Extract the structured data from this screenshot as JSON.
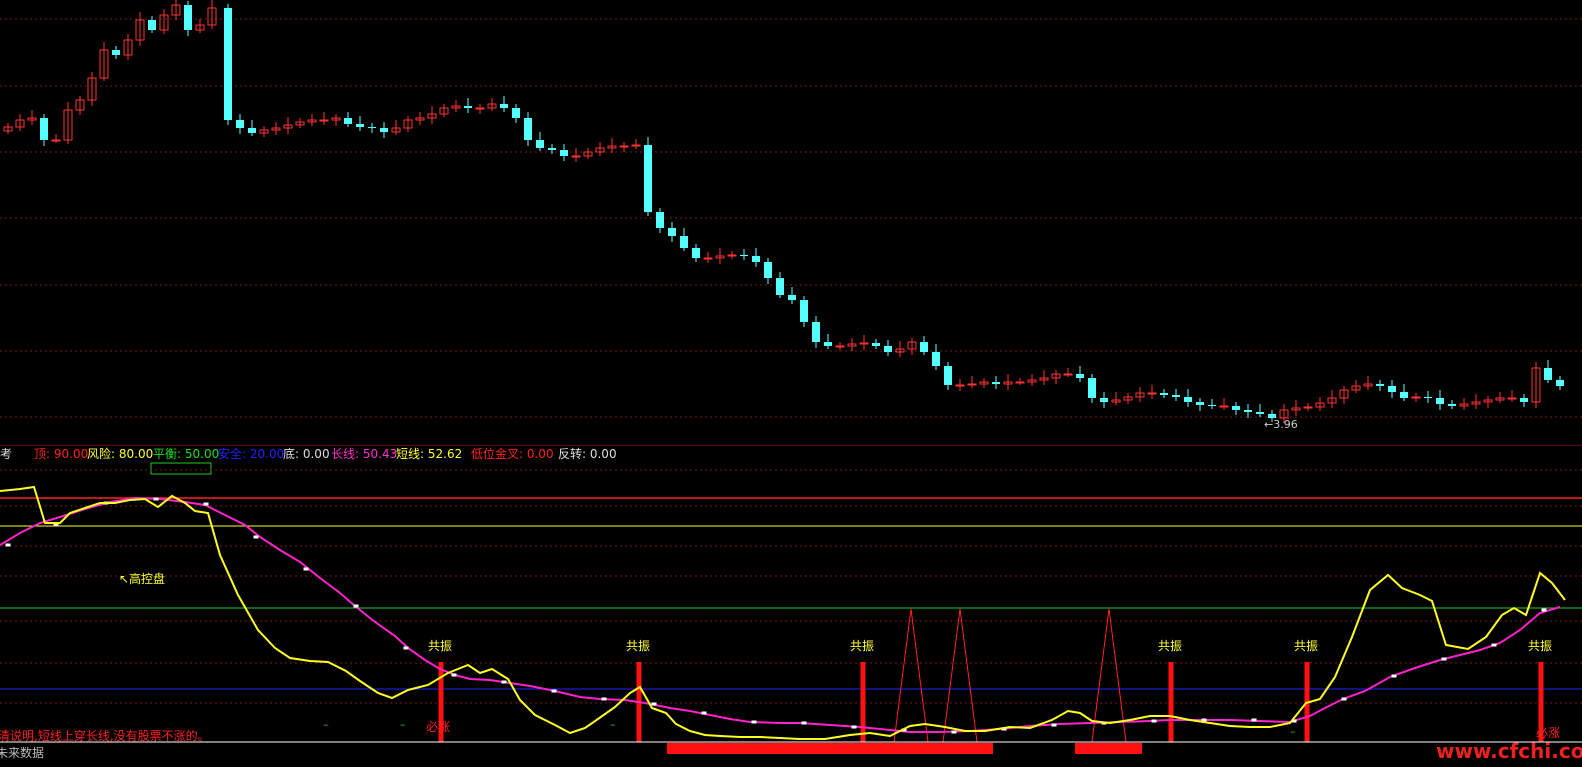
{
  "price": {
    "low_marker": "←3.96",
    "colors": {
      "up": "#ff3333",
      "down": "#54ffff",
      "grid": "#7a1a1a"
    }
  },
  "indicator": {
    "legend_prefix": "考",
    "legend": [
      {
        "label": "顶:",
        "value": "90.00",
        "color": "#ff2020"
      },
      {
        "label": "风险:",
        "value": "80.00",
        "color": "#ffff33"
      },
      {
        "label": "平衡:",
        "value": "50.00",
        "color": "#22dd22"
      },
      {
        "label": "安全:",
        "value": "20.00",
        "color": "#2020ff"
      },
      {
        "label": "底:",
        "value": "0.00",
        "color": "#dddddd"
      },
      {
        "label": "长线:",
        "value": "50.43",
        "color": "#ff33cc"
      },
      {
        "label": "短线:",
        "value": "52.62",
        "color": "#ffff33"
      },
      {
        "label": "低位金叉:",
        "value": "0.00",
        "color": "#ff2020"
      },
      {
        "label": "反转:",
        "value": "0.00",
        "color": "#dddddd"
      }
    ],
    "annotation_high_control": "↖高控盘",
    "resonance_label": "共振",
    "must_rise_label": "必涨",
    "bottom_note": "清说明,短线上穿长线,没有股票不涨的。",
    "bottom_left_text": "未来数据",
    "watermark": "www.cfchi.com",
    "dash_mark": "–"
  }
}
